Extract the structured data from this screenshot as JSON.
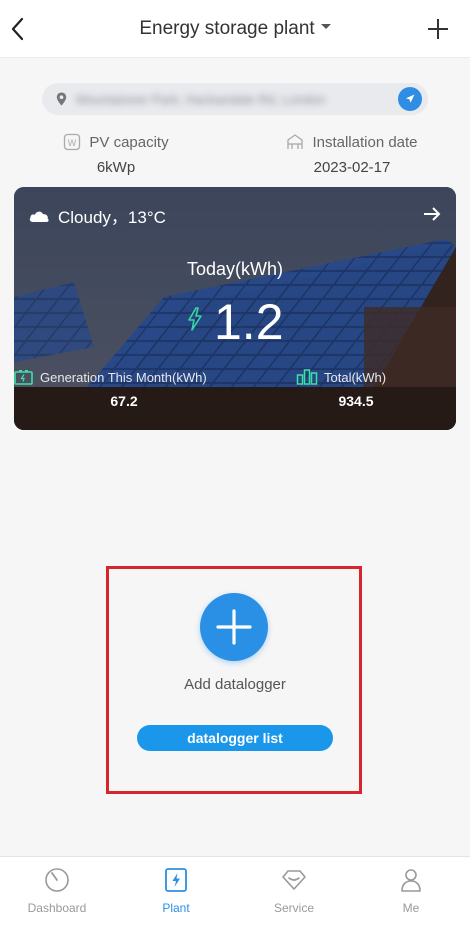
{
  "header": {
    "title": "Energy storage plant"
  },
  "address": {
    "text": "Mountaineer Park, Hackandale Rd, London"
  },
  "info": {
    "pv_capacity_label": "PV capacity",
    "pv_capacity_value": "6kWp",
    "installation_date_label": "Installation date",
    "installation_date_value": "2023-02-17"
  },
  "card": {
    "weather": "Cloudy，13°C",
    "today_label": "Today(kWh)",
    "today_value": "1.2",
    "month_label": "Generation This Month(kWh)",
    "month_value": "67.2",
    "total_label": "Total(kWh)",
    "total_value": "934.5"
  },
  "datalogger": {
    "add_label": "Add datalogger",
    "list_label": "datalogger list"
  },
  "tabs": [
    {
      "label": "Dashboard"
    },
    {
      "label": "Plant"
    },
    {
      "label": "Service"
    },
    {
      "label": "Me"
    }
  ],
  "colors": {
    "accent": "#2a90e6",
    "highlight": "#d6252b"
  }
}
